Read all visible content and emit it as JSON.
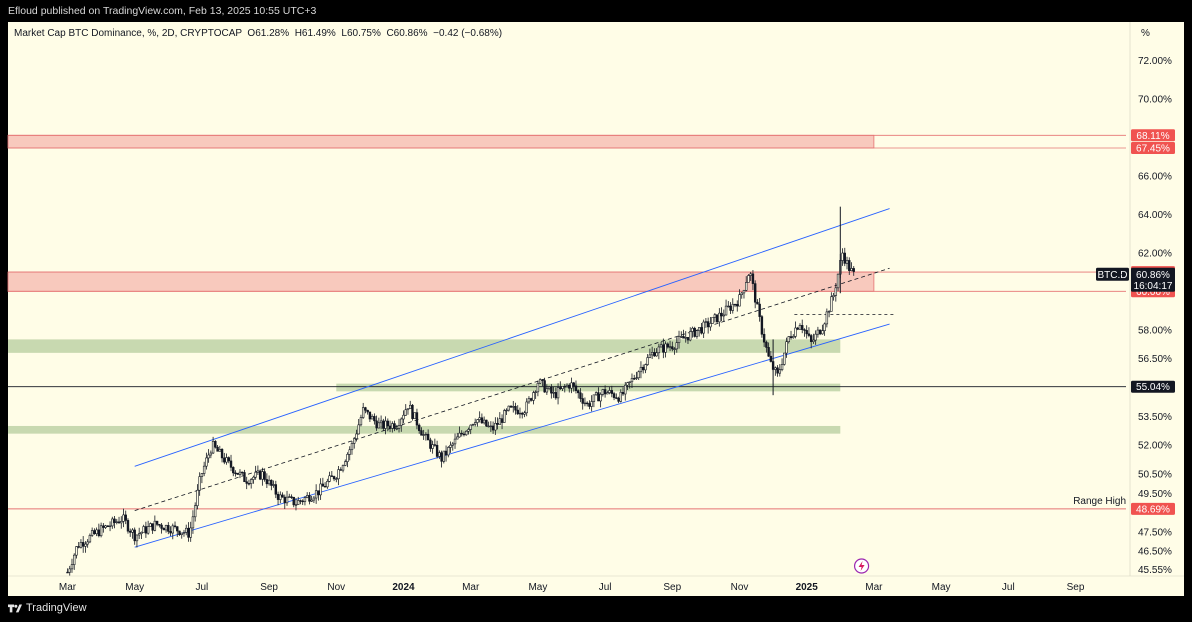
{
  "publish_note": "Efloud published on TradingView.com, Feb 13, 2025 10:55 UTC+3",
  "legend": {
    "name": "Market Cap BTC Dominance, %, 2D, CRYPTOCAP",
    "open": "O61.28%",
    "high": "H61.49%",
    "low": "L60.75%",
    "close": "C60.86%",
    "change": "−0.42 (−0.68%)"
  },
  "footer": {
    "brand": "TradingView"
  },
  "colors": {
    "background": "#fffde7",
    "candle": "#131722",
    "channel": "#2962ff",
    "resistance_zone": "#f8c9bd",
    "resistance_line": "#e57373",
    "support_zone": "#c8d9b0",
    "label_red": "#f05350",
    "label_black": "#131722"
  },
  "chart_data": {
    "type": "candlestick",
    "symbol": "BTC.D",
    "unit": "%",
    "y_axis_unit_label": "%",
    "ylim": [
      45.2,
      74.0
    ],
    "y_ticks": [
      "72.00%",
      "70.00%",
      "66.00%",
      "64.00%",
      "62.00%",
      "58.00%",
      "56.50%",
      "53.50%",
      "52.00%",
      "50.50%",
      "49.50%",
      "47.50%",
      "46.50%",
      "45.55%"
    ],
    "x_ticks": [
      {
        "label": "Mar",
        "bold": false
      },
      {
        "label": "May",
        "bold": false
      },
      {
        "label": "Jul",
        "bold": false
      },
      {
        "label": "Sep",
        "bold": false
      },
      {
        "label": "Nov",
        "bold": false
      },
      {
        "label": "2024",
        "bold": true
      },
      {
        "label": "Mar",
        "bold": false
      },
      {
        "label": "May",
        "bold": false
      },
      {
        "label": "Jul",
        "bold": false
      },
      {
        "label": "Sep",
        "bold": false
      },
      {
        "label": "Nov",
        "bold": false
      },
      {
        "label": "2025",
        "bold": true
      },
      {
        "label": "Mar",
        "bold": false
      },
      {
        "label": "May",
        "bold": false
      },
      {
        "label": "Jul",
        "bold": false
      },
      {
        "label": "Sep",
        "bold": false
      }
    ],
    "x_range_months": [
      "2023-02",
      "2025-10"
    ],
    "last": {
      "value": 60.86,
      "label": "60.86%",
      "symbol_label": "BTC.D",
      "countdown": "16:04:17"
    },
    "price_labels": [
      {
        "text": "68.11%",
        "value": 68.11,
        "style": "red"
      },
      {
        "text": "67.45%",
        "value": 67.45,
        "style": "red"
      },
      {
        "text": "61.00%",
        "value": 61.0,
        "style": "red"
      },
      {
        "text": "60.00%",
        "value": 60.0,
        "style": "red"
      },
      {
        "text": "55.04%",
        "value": 55.04,
        "style": "black"
      },
      {
        "text": "48.69%",
        "value": 48.69,
        "style": "red"
      }
    ],
    "zones": [
      {
        "kind": "resistance",
        "from": 67.45,
        "to": 68.11,
        "start": "2023-01",
        "end": "2025-03"
      },
      {
        "kind": "resistance",
        "from": 60.0,
        "to": 61.0,
        "start": "2023-01",
        "end": "2025-03"
      },
      {
        "kind": "support",
        "from": 56.8,
        "to": 57.5,
        "start": "2023-01",
        "end": "2025-02"
      },
      {
        "kind": "support",
        "from": 54.8,
        "to": 55.2,
        "start": "2023-11",
        "end": "2025-02"
      },
      {
        "kind": "support",
        "from": 52.6,
        "to": 53.0,
        "start": "2023-01",
        "end": "2025-02"
      }
    ],
    "horizontal_lines": [
      {
        "value": 55.04,
        "color": "black",
        "note": "55.04%"
      },
      {
        "value": 48.69,
        "color": "red",
        "note": "Range High"
      }
    ],
    "annotations": [
      {
        "text": "Range High",
        "value": 48.69
      }
    ],
    "channel": {
      "upper": [
        [
          "2023-05-01",
          50.9
        ],
        [
          "2025-03-15",
          64.3
        ]
      ],
      "lower": [
        [
          "2023-05-01",
          46.7
        ],
        [
          "2025-03-15",
          58.3
        ]
      ],
      "mid": [
        [
          "2023-05-01",
          48.6
        ],
        [
          "2025-03-15",
          61.2
        ]
      ]
    },
    "series_anchors": [
      [
        "2023-03-01",
        45.4
      ],
      [
        "2023-03-10",
        46.8
      ],
      [
        "2023-04-01",
        47.6
      ],
      [
        "2023-04-20",
        48.2
      ],
      [
        "2023-05-01",
        47.3
      ],
      [
        "2023-05-20",
        47.9
      ],
      [
        "2023-06-10",
        47.6
      ],
      [
        "2023-06-20",
        47.4
      ],
      [
        "2023-06-30",
        50.4
      ],
      [
        "2023-07-10",
        52.0
      ],
      [
        "2023-07-25",
        51.0
      ],
      [
        "2023-08-10",
        50.2
      ],
      [
        "2023-08-25",
        50.5
      ],
      [
        "2023-09-10",
        49.3
      ],
      [
        "2023-09-25",
        49.0
      ],
      [
        "2023-10-15",
        49.6
      ],
      [
        "2023-11-01",
        50.5
      ],
      [
        "2023-11-15",
        52.0
      ],
      [
        "2023-11-25",
        53.8
      ],
      [
        "2023-12-10",
        53.0
      ],
      [
        "2023-12-25",
        53.1
      ],
      [
        "2024-01-05",
        54.1
      ],
      [
        "2024-01-20",
        52.4
      ],
      [
        "2024-02-05",
        51.3
      ],
      [
        "2024-02-20",
        52.4
      ],
      [
        "2024-03-05",
        53.4
      ],
      [
        "2024-03-20",
        52.8
      ],
      [
        "2024-04-05",
        53.8
      ],
      [
        "2024-04-20",
        53.9
      ],
      [
        "2024-05-01",
        55.3
      ],
      [
        "2024-05-15",
        54.6
      ],
      [
        "2024-05-30",
        55.2
      ],
      [
        "2024-06-15",
        54.1
      ],
      [
        "2024-06-30",
        54.8
      ],
      [
        "2024-07-15",
        54.5
      ],
      [
        "2024-08-01",
        55.9
      ],
      [
        "2024-08-15",
        56.9
      ],
      [
        "2024-09-01",
        57.2
      ],
      [
        "2024-09-15",
        57.7
      ],
      [
        "2024-10-01",
        58.2
      ],
      [
        "2024-10-15",
        58.8
      ],
      [
        "2024-11-01",
        59.6
      ],
      [
        "2024-11-10",
        61.1
      ],
      [
        "2024-11-20",
        58.2
      ],
      [
        "2024-11-28",
        56.3
      ],
      [
        "2024-12-05",
        55.6
      ],
      [
        "2024-12-15",
        57.6
      ],
      [
        "2024-12-25",
        58.4
      ],
      [
        "2025-01-05",
        57.3
      ],
      [
        "2025-01-15",
        58.2
      ],
      [
        "2025-01-25",
        59.8
      ],
      [
        "2025-02-03",
        62.0
      ],
      [
        "2025-02-08",
        61.3
      ],
      [
        "2025-02-13",
        60.86
      ]
    ]
  }
}
